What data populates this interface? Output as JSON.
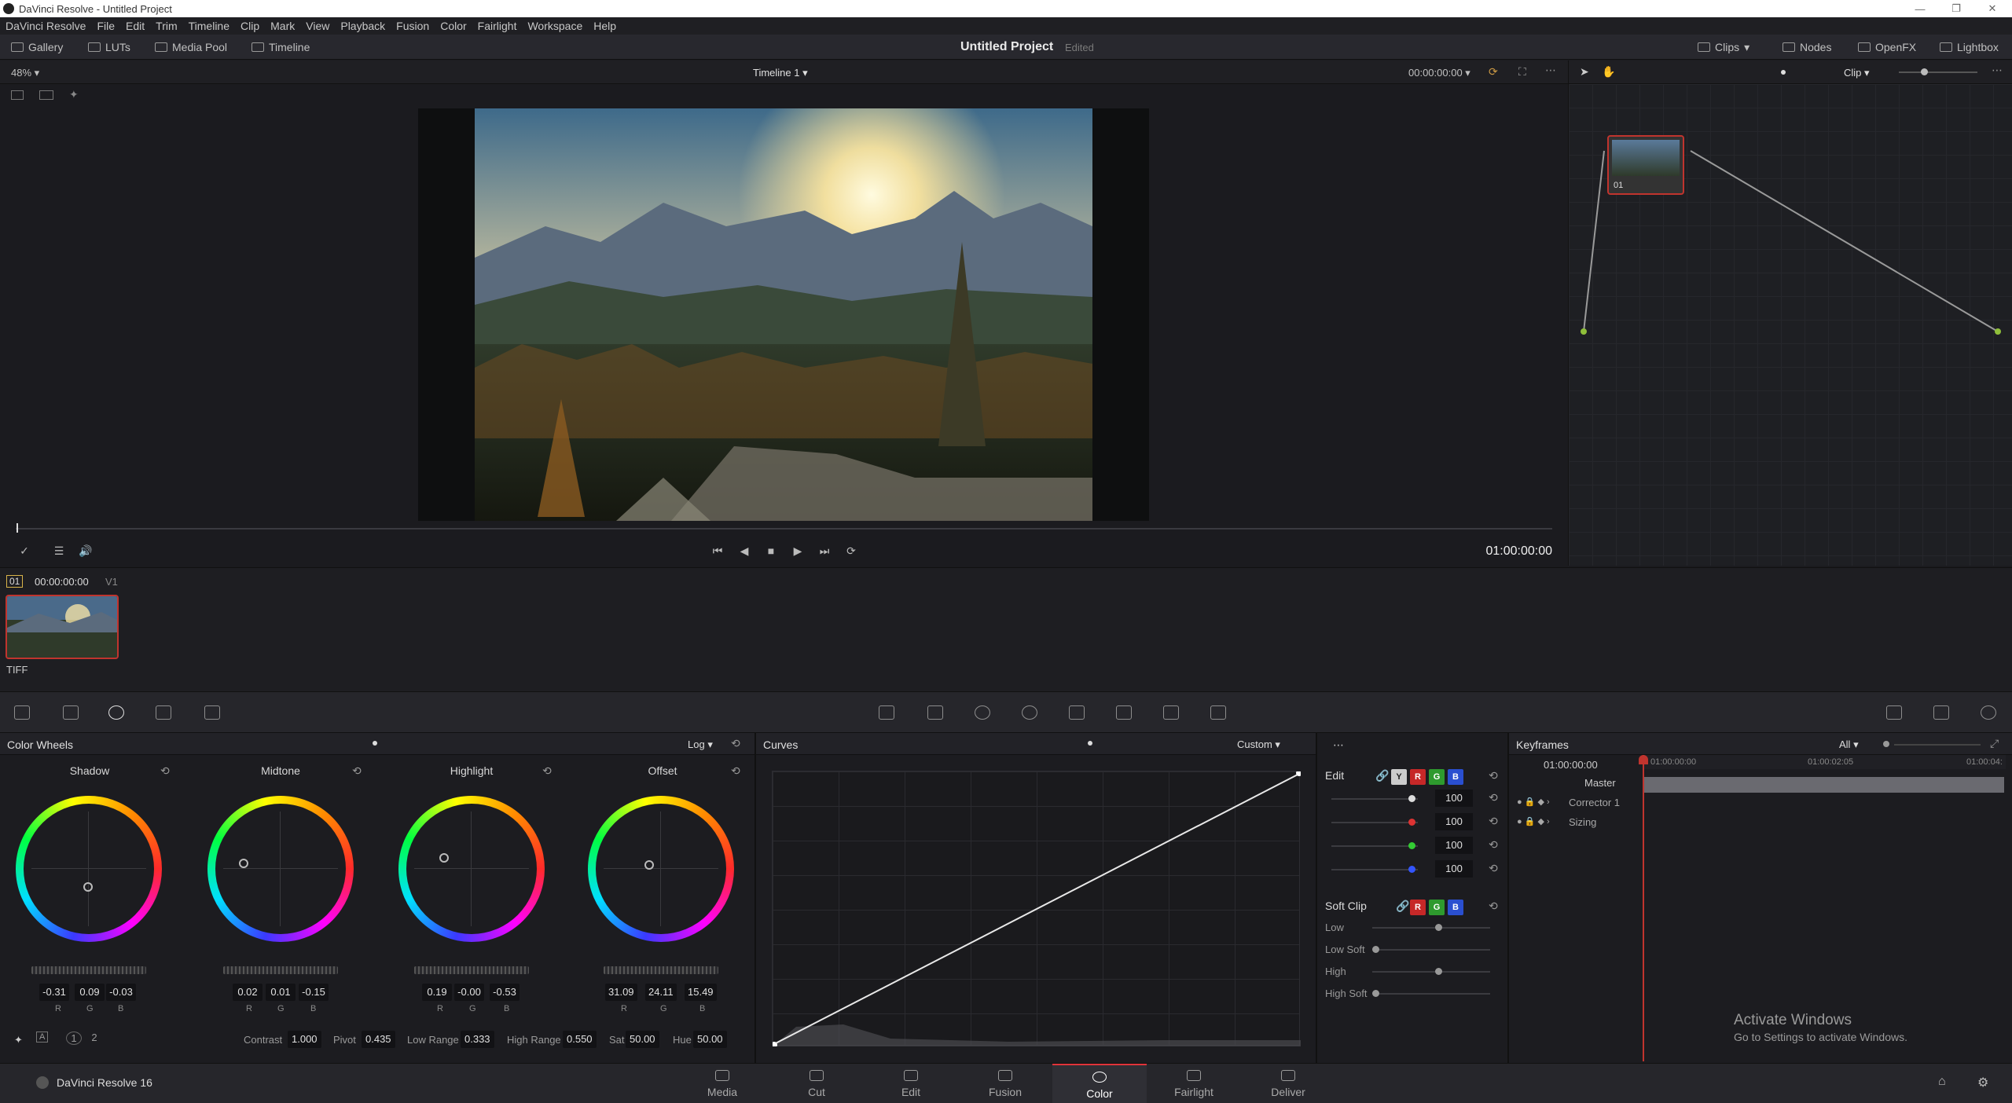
{
  "app": {
    "window_title": "DaVinci Resolve - Untitled Project",
    "product": "DaVinci Resolve 16"
  },
  "menu": [
    "DaVinci Resolve",
    "File",
    "Edit",
    "Trim",
    "Timeline",
    "Clip",
    "Mark",
    "View",
    "Playback",
    "Fusion",
    "Color",
    "Fairlight",
    "Workspace",
    "Help"
  ],
  "toolbar": {
    "left": [
      "Gallery",
      "LUTs",
      "Media Pool",
      "Timeline"
    ],
    "project_title": "Untitled Project",
    "project_status": "Edited",
    "right": [
      "Clips",
      "Nodes",
      "OpenFX",
      "Lightbox"
    ]
  },
  "viewer": {
    "zoom": "48%",
    "timeline_name": "Timeline 1",
    "timecode_top": "00:00:00:00",
    "timecode": "01:00:00:00"
  },
  "node_editor": {
    "mode": "Clip",
    "node_label": "01"
  },
  "clips": {
    "index": "01",
    "timecode": "00:00:00:00",
    "track": "V1",
    "format": "TIFF"
  },
  "color_wheels": {
    "title": "Color Wheels",
    "mode": "Log",
    "wheels": [
      {
        "name": "Shadow",
        "values": [
          "-0.31",
          "0.09",
          "-0.03"
        ]
      },
      {
        "name": "Midtone",
        "values": [
          "0.02",
          "0.01",
          "-0.15"
        ]
      },
      {
        "name": "Highlight",
        "values": [
          "0.19",
          "-0.00",
          "-0.53"
        ]
      },
      {
        "name": "Offset",
        "values": [
          "31.09",
          "24.11",
          "15.49"
        ]
      }
    ],
    "channels": [
      "R",
      "G",
      "B"
    ],
    "pages": [
      "1",
      "2"
    ],
    "adjust": {
      "contrast_label": "Contrast",
      "contrast": "1.000",
      "pivot_label": "Pivot",
      "pivot": "0.435",
      "low_range_label": "Low Range",
      "low_range": "0.333",
      "high_range_label": "High Range",
      "high_range": "0.550",
      "sat_label": "Sat",
      "sat": "50.00",
      "hue_label": "Hue",
      "hue": "50.00"
    }
  },
  "curves": {
    "title": "Curves",
    "mode": "Custom",
    "edit_label": "Edit",
    "channel_buttons": [
      "Y",
      "R",
      "G",
      "B"
    ],
    "edit_values": [
      "100",
      "100",
      "100",
      "100"
    ],
    "soft_clip_label": "Soft Clip",
    "soft_clip_rows": [
      "Low",
      "Low Soft",
      "High",
      "High Soft"
    ]
  },
  "keyframes": {
    "title": "Keyframes",
    "filter": "All",
    "timecode": "01:00:00:00",
    "ruler": [
      "01:00:00:00",
      "01:00:02:05",
      "01:00:04:"
    ],
    "rows": [
      "Master",
      "Corrector 1",
      "Sizing"
    ]
  },
  "watermark": {
    "title": "Activate Windows",
    "subtitle": "Go to Settings to activate Windows."
  },
  "pages": [
    "Media",
    "Cut",
    "Edit",
    "Fusion",
    "Color",
    "Fairlight",
    "Deliver"
  ],
  "active_page": "Color",
  "colors": {
    "accent_red": "#e0333a",
    "node_border": "#c0342e",
    "node_line": "#9a9a9a"
  }
}
